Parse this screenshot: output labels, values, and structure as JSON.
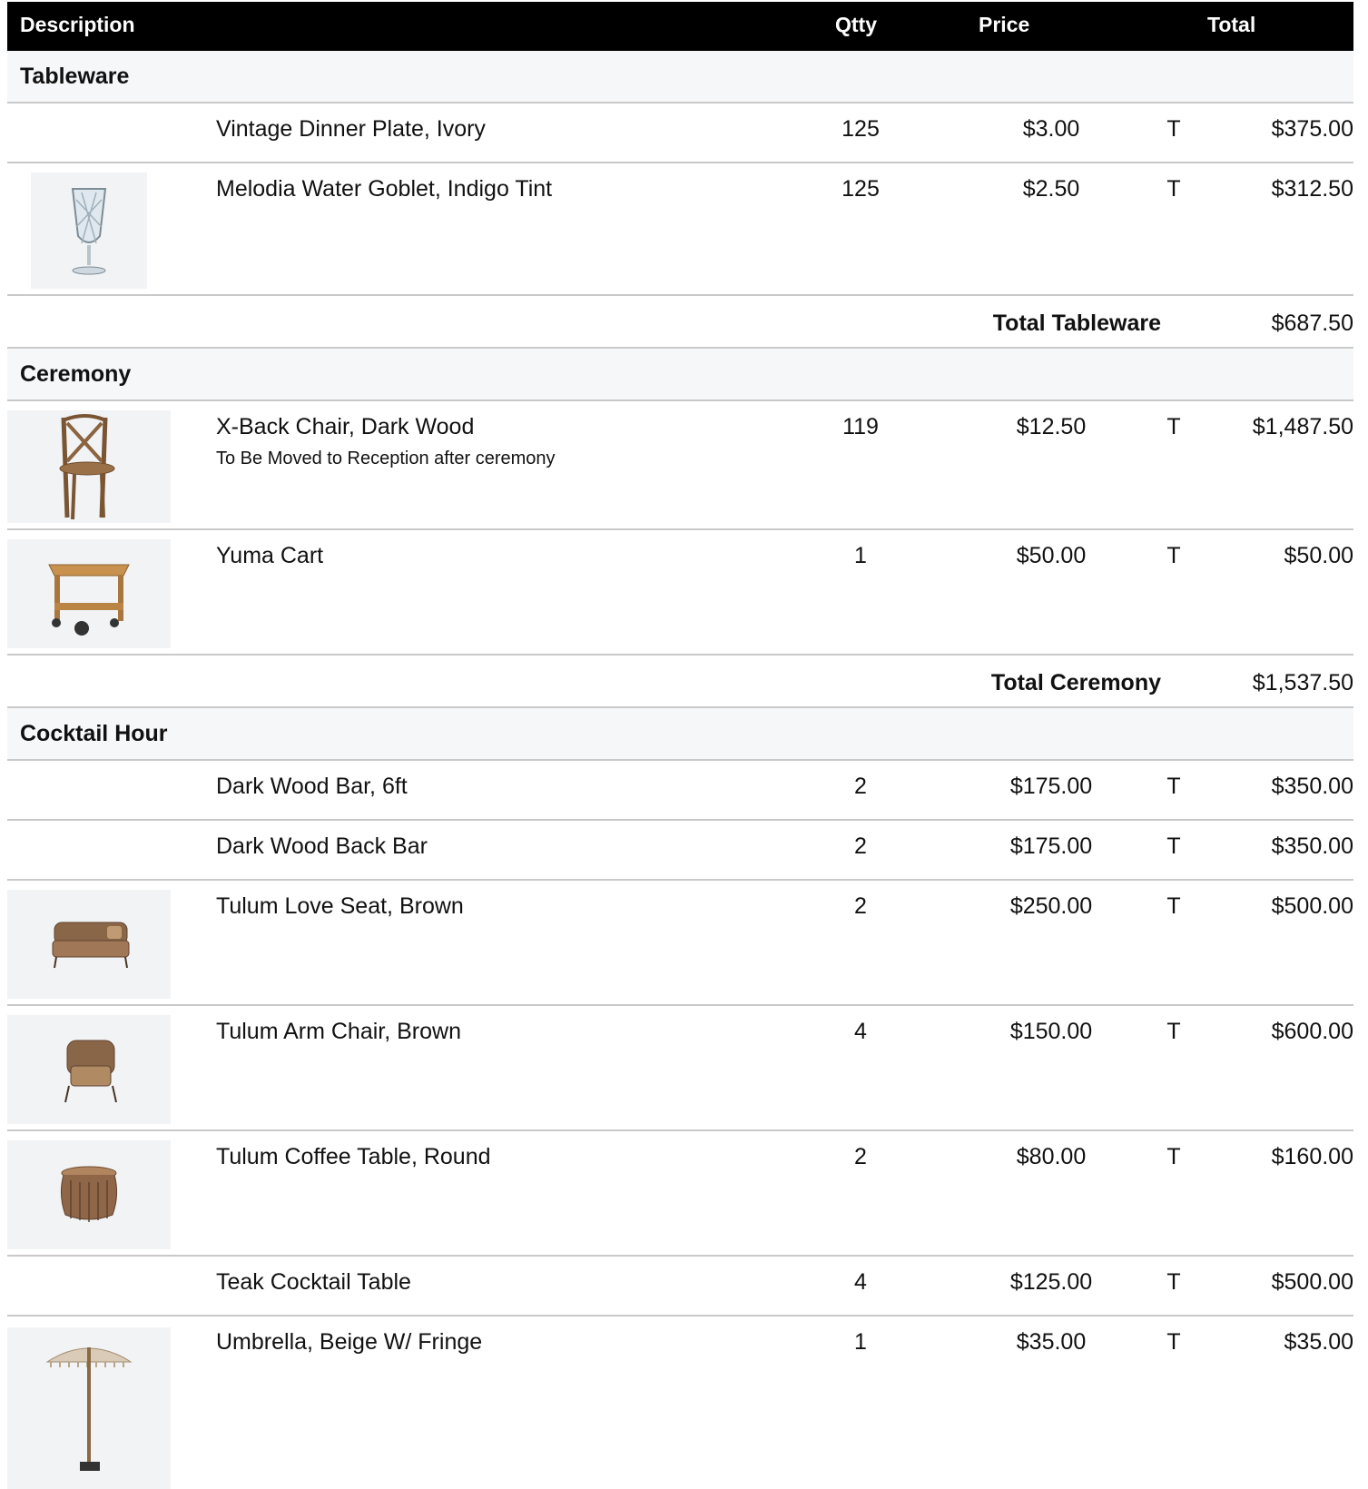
{
  "header": {
    "description": "Description",
    "qty": "Qtty",
    "price": "Price",
    "total": "Total"
  },
  "sections": [
    {
      "name": "Tableware",
      "items": [
        {
          "description": "Vintage Dinner Plate, Ivory",
          "qty": "125",
          "price": "$3.00",
          "tax": "T",
          "total": "$375.00",
          "image": "none"
        },
        {
          "description": "Melodia Water Goblet, Indigo Tint",
          "qty": "125",
          "price": "$2.50",
          "tax": "T",
          "total": "$312.50",
          "image": "goblet-icon"
        }
      ],
      "subtotal_label": "Total Tableware",
      "subtotal": "$687.50"
    },
    {
      "name": "Ceremony",
      "items": [
        {
          "description": "X-Back Chair, Dark Wood",
          "note": "To Be Moved to Reception after ceremony",
          "qty": "119",
          "price": "$12.50",
          "tax": "T",
          "total": "$1,487.50",
          "image": "x-back-chair-icon"
        },
        {
          "description": "Yuma Cart",
          "qty": "1",
          "price": "$50.00",
          "tax": "T",
          "total": "$50.00",
          "image": "cart-icon"
        }
      ],
      "subtotal_label": "Total Ceremony",
      "subtotal": "$1,537.50"
    },
    {
      "name": "Cocktail Hour",
      "items": [
        {
          "description": "Dark Wood Bar, 6ft",
          "qty": "2",
          "price": "$175.00",
          "tax": "T",
          "total": "$350.00",
          "image": "none"
        },
        {
          "description": "Dark Wood Back Bar",
          "qty": "2",
          "price": "$175.00",
          "tax": "T",
          "total": "$350.00",
          "image": "none"
        },
        {
          "description": "Tulum Love Seat, Brown",
          "qty": "2",
          "price": "$250.00",
          "tax": "T",
          "total": "$500.00",
          "image": "love-seat-icon"
        },
        {
          "description": "Tulum Arm Chair, Brown",
          "qty": "4",
          "price": "$150.00",
          "tax": "T",
          "total": "$600.00",
          "image": "arm-chair-icon"
        },
        {
          "description": "Tulum Coffee Table, Round",
          "qty": "2",
          "price": "$80.00",
          "tax": "T",
          "total": "$160.00",
          "image": "coffee-table-icon"
        },
        {
          "description": "Teak Cocktail Table",
          "qty": "4",
          "price": "$125.00",
          "tax": "T",
          "total": "$500.00",
          "image": "none"
        },
        {
          "description": "Umbrella, Beige W/ Fringe",
          "qty": "1",
          "price": "$35.00",
          "tax": "T",
          "total": "$35.00",
          "image": "umbrella-icon"
        }
      ]
    }
  ]
}
